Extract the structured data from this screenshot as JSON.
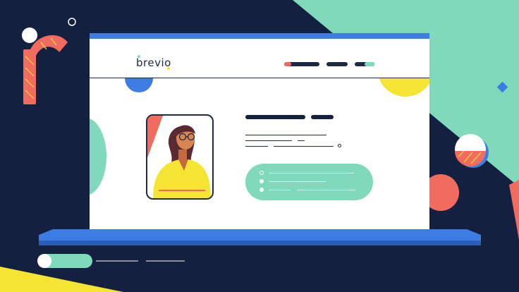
{
  "brand": {
    "name": "brevio"
  },
  "colors": {
    "navy": "#142040",
    "blue": "#3b7de3",
    "mint": "#7fd9ba",
    "yellow": "#f6e433",
    "coral": "#f26b5f",
    "white": "#ffffff"
  },
  "icons": [
    "letter-r-shape",
    "circle-outline",
    "diamond-shape",
    "striped-ball",
    "person-avatar"
  ]
}
